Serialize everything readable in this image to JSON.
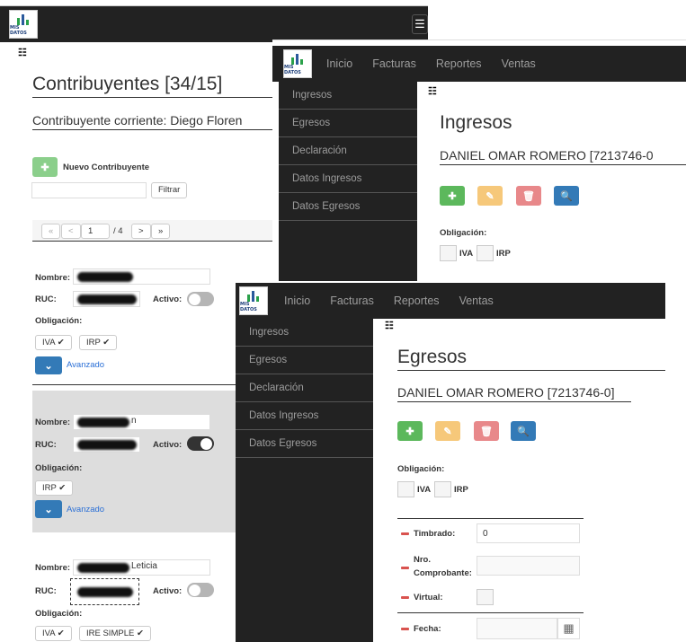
{
  "win1": {
    "title": "Contribuyentes [34/15]",
    "current": "Contribuyente corriente: Diego Floren",
    "new_button": "Nuevo Contribuyente",
    "filter_button": "Filtrar",
    "filter_value": "",
    "pagination": {
      "first": "«",
      "prev": "<",
      "page": "1",
      "of": "/ 4",
      "next": ">",
      "last": "»"
    },
    "cards": [
      {
        "name_label": "Nombre:",
        "ruc_label": "RUC:",
        "active_label": "Activo:",
        "obligation_label": "Obligación:",
        "obligations": [
          "IVA ✔",
          "IRP ✔"
        ],
        "advanced": "Avanzado",
        "name_suffix": ""
      },
      {
        "name_label": "Nombre:",
        "ruc_label": "RUC:",
        "active_label": "Activo:",
        "obligation_label": "Obligación:",
        "obligations": [
          "IRP ✔"
        ],
        "advanced": "Avanzado",
        "name_suffix": "n"
      },
      {
        "name_label": "Nombre:",
        "ruc_label": "RUC:",
        "active_label": "Activo:",
        "obligation_label": "Obligación:",
        "obligations": [
          "IVA ✔",
          "IRE SIMPLE ✔"
        ],
        "name_suffix": "Leticia"
      }
    ]
  },
  "win2": {
    "nav": [
      "Inicio",
      "Facturas",
      "Reportes",
      "Ventas"
    ],
    "sidebar": [
      "Ingresos",
      "Egresos",
      "Declaración",
      "Datos Ingresos",
      "Datos Egresos"
    ],
    "title": "Ingresos",
    "subtitle": "DANIEL OMAR ROMERO [7213746-0",
    "obligation_label": "Obligación:",
    "options": [
      "IVA",
      "IRP"
    ]
  },
  "win3": {
    "nav": [
      "Inicio",
      "Facturas",
      "Reportes",
      "Ventas"
    ],
    "sidebar": [
      "Ingresos",
      "Egresos",
      "Declaración",
      "Datos Ingresos",
      "Datos Egresos"
    ],
    "title": "Egresos",
    "subtitle": "DANIEL OMAR ROMERO [7213746-0]",
    "obligation_label": "Obligación:",
    "options": [
      "IVA",
      "IRP"
    ],
    "fields": {
      "timbrado_label": "Timbrado:",
      "timbrado_value": "0",
      "comprobante_label": "Nro. Comprobante:",
      "virtual_label": "Virtual:",
      "fecha_label": "Fecha:"
    }
  },
  "logo_text": "MIS DATOS",
  "icons": {
    "add": "plus-icon",
    "edit": "edit-icon",
    "delete": "trash-icon",
    "search": "search-icon",
    "menu": "list-icon",
    "calendar": "calendar-icon",
    "chevron": "chevron-down-icon"
  },
  "colors": {
    "navbar": "#222222",
    "green": "#5cb85c",
    "orange": "#f6c87a",
    "red": "#e8888a",
    "blue": "#337ab7",
    "link": "#2a6fd6"
  }
}
